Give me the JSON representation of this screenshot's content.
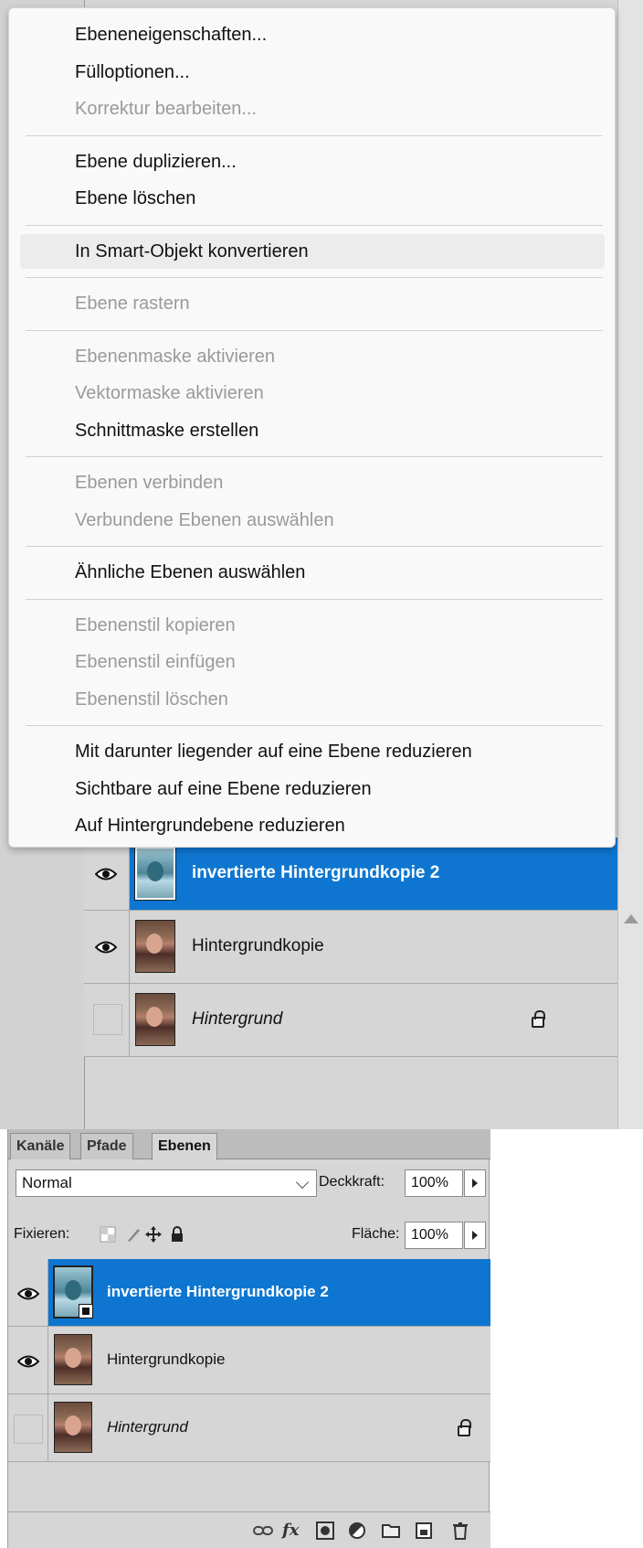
{
  "context_menu": {
    "groups": [
      [
        {
          "label": "Ebeneneigenschaften...",
          "enabled": true
        },
        {
          "label": "Fülloptionen...",
          "enabled": true
        },
        {
          "label": "Korrektur bearbeiten...",
          "enabled": false
        }
      ],
      [
        {
          "label": "Ebene duplizieren...",
          "enabled": true
        },
        {
          "label": "Ebene löschen",
          "enabled": true
        }
      ],
      [
        {
          "label": "In Smart-Objekt konvertieren",
          "enabled": true,
          "hovered": true
        }
      ],
      [
        {
          "label": "Ebene rastern",
          "enabled": false
        }
      ],
      [
        {
          "label": "Ebenenmaske aktivieren",
          "enabled": false
        },
        {
          "label": "Vektormaske aktivieren",
          "enabled": false
        },
        {
          "label": "Schnittmaske erstellen",
          "enabled": true
        }
      ],
      [
        {
          "label": "Ebenen verbinden",
          "enabled": false
        },
        {
          "label": "Verbundene Ebenen auswählen",
          "enabled": false
        }
      ],
      [
        {
          "label": "Ähnliche Ebenen auswählen",
          "enabled": true
        }
      ],
      [
        {
          "label": "Ebenenstil kopieren",
          "enabled": false
        },
        {
          "label": "Ebenenstil einfügen",
          "enabled": false
        },
        {
          "label": "Ebenenstil löschen",
          "enabled": false
        }
      ],
      [
        {
          "label": "Mit darunter liegender auf eine Ebene reduzieren",
          "enabled": true
        },
        {
          "label": "Sichtbare auf eine Ebene reduzieren",
          "enabled": true
        },
        {
          "label": "Auf Hintergrundebene reduzieren",
          "enabled": true
        }
      ]
    ]
  },
  "layers": [
    {
      "name": "invertierte Hintergrundkopie 2",
      "visible": true,
      "selected": true,
      "thumb": "inverted",
      "smart_object": true
    },
    {
      "name": "Hintergrundkopie",
      "visible": true,
      "selected": false,
      "thumb": "photo"
    },
    {
      "name": "Hintergrund",
      "visible": false,
      "selected": false,
      "thumb": "photo",
      "italic": true,
      "locked": true
    }
  ],
  "panel": {
    "tabs": [
      "Kanäle",
      "Pfade",
      "Ebenen"
    ],
    "active_tab": "Ebenen",
    "blend_mode": "Normal",
    "opacity_label": "Deckkraft:",
    "opacity_value": "100%",
    "lock_label": "Fixieren:",
    "fill_label": "Fläche:",
    "fill_value": "100%",
    "footer_icons": [
      "link-icon",
      "fx-icon",
      "mask-icon",
      "adjustment-icon",
      "folder-icon",
      "new-layer-icon",
      "trash-icon"
    ],
    "fx_text": "fx"
  },
  "colors": {
    "selection": "#0e76d0",
    "panel": "#d6d6d6",
    "menu_bg": "#f9f9f9",
    "disabled_text": "#9a9a9a"
  }
}
